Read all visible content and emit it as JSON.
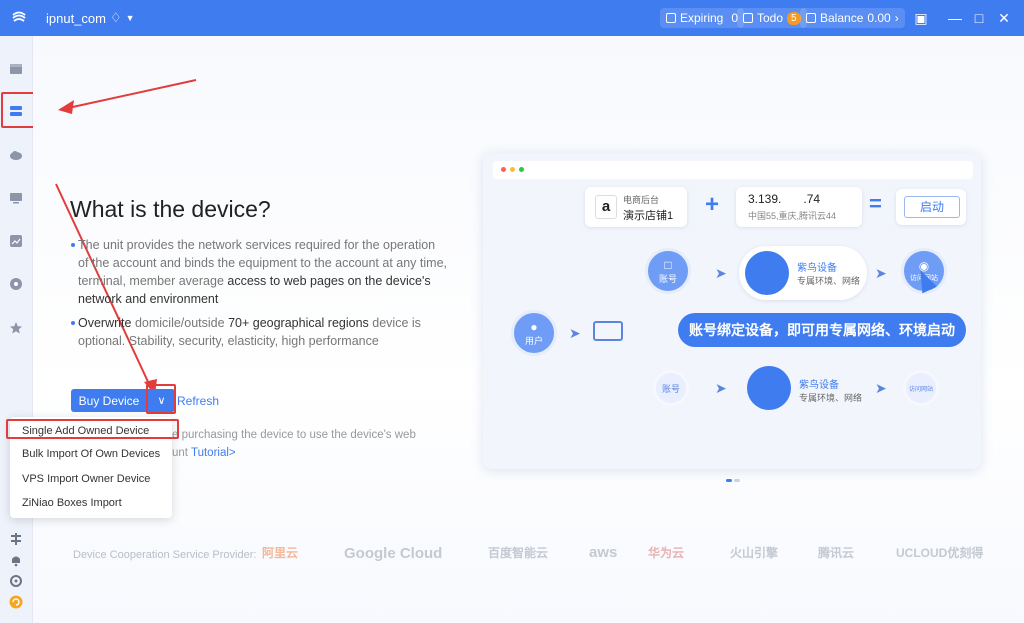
{
  "titlebar": {
    "account": "ipnut_com",
    "expiring_label": "Expiring",
    "expiring_count": "0",
    "todo_label": "Todo",
    "todo_count": "5",
    "balance_label": "Balance",
    "balance_value": "0.00",
    "accent": "#3f7cf0"
  },
  "sidebar": {
    "icons": [
      "store-icon",
      "device-icon",
      "cloud-icon",
      "monitor-icon",
      "image-icon",
      "compass-icon",
      "star-icon",
      "tool-icon",
      "bell-icon",
      "settings-icon",
      "sync-icon"
    ]
  },
  "main": {
    "heading": "What is the device?",
    "bullet1_a": "The unit provides the network services required for the operation of the account and binds the equipment to the account at any time, terminal, member average ",
    "bullet1_b": "access to web pages on the device's network and environment",
    "bullet2_a": "Overwrite",
    "bullet2_b": " domicile/outside ",
    "bullet2_c": "70+ geographical regions",
    "bullet2_d": " device is optional. Stability, security, elasticity, high performance",
    "buy_button": "Buy Device",
    "refresh": "Refresh",
    "hint_line1": "e purchasing the device to use the device's web",
    "hint_line2_a": "unt ",
    "hint_line2_link": "Tutorial>"
  },
  "dropdown": {
    "items": [
      "Single Add Owned Device",
      "Bulk Import Of Own Devices",
      "VPS Import Owner Device",
      "ZiNiao Boxes Import"
    ]
  },
  "providers": {
    "label": "Device Cooperation Service Provider:",
    "names": [
      "阿里云",
      "Google Cloud",
      "百度智能云",
      "aws",
      "华为云",
      "火山引擎",
      "腾讯云",
      "UCLOUD优刻得"
    ]
  },
  "diagram": {
    "store_line1": "电商后台",
    "store_line2": "演示店铺1",
    "ip_line1": "3.139.",
    "ip_masked": "   ",
    "ip_tail": ".74",
    "ip_line2": "中国55,重庆,腾讯云44",
    "launch": "启动",
    "user": "用户",
    "account": "账号",
    "device_title": "紫鸟设备",
    "device_sub": "专属环境、网络",
    "visit": "访问网站",
    "banner": "账号绑定设备，即可用专属网络、环境启动"
  }
}
